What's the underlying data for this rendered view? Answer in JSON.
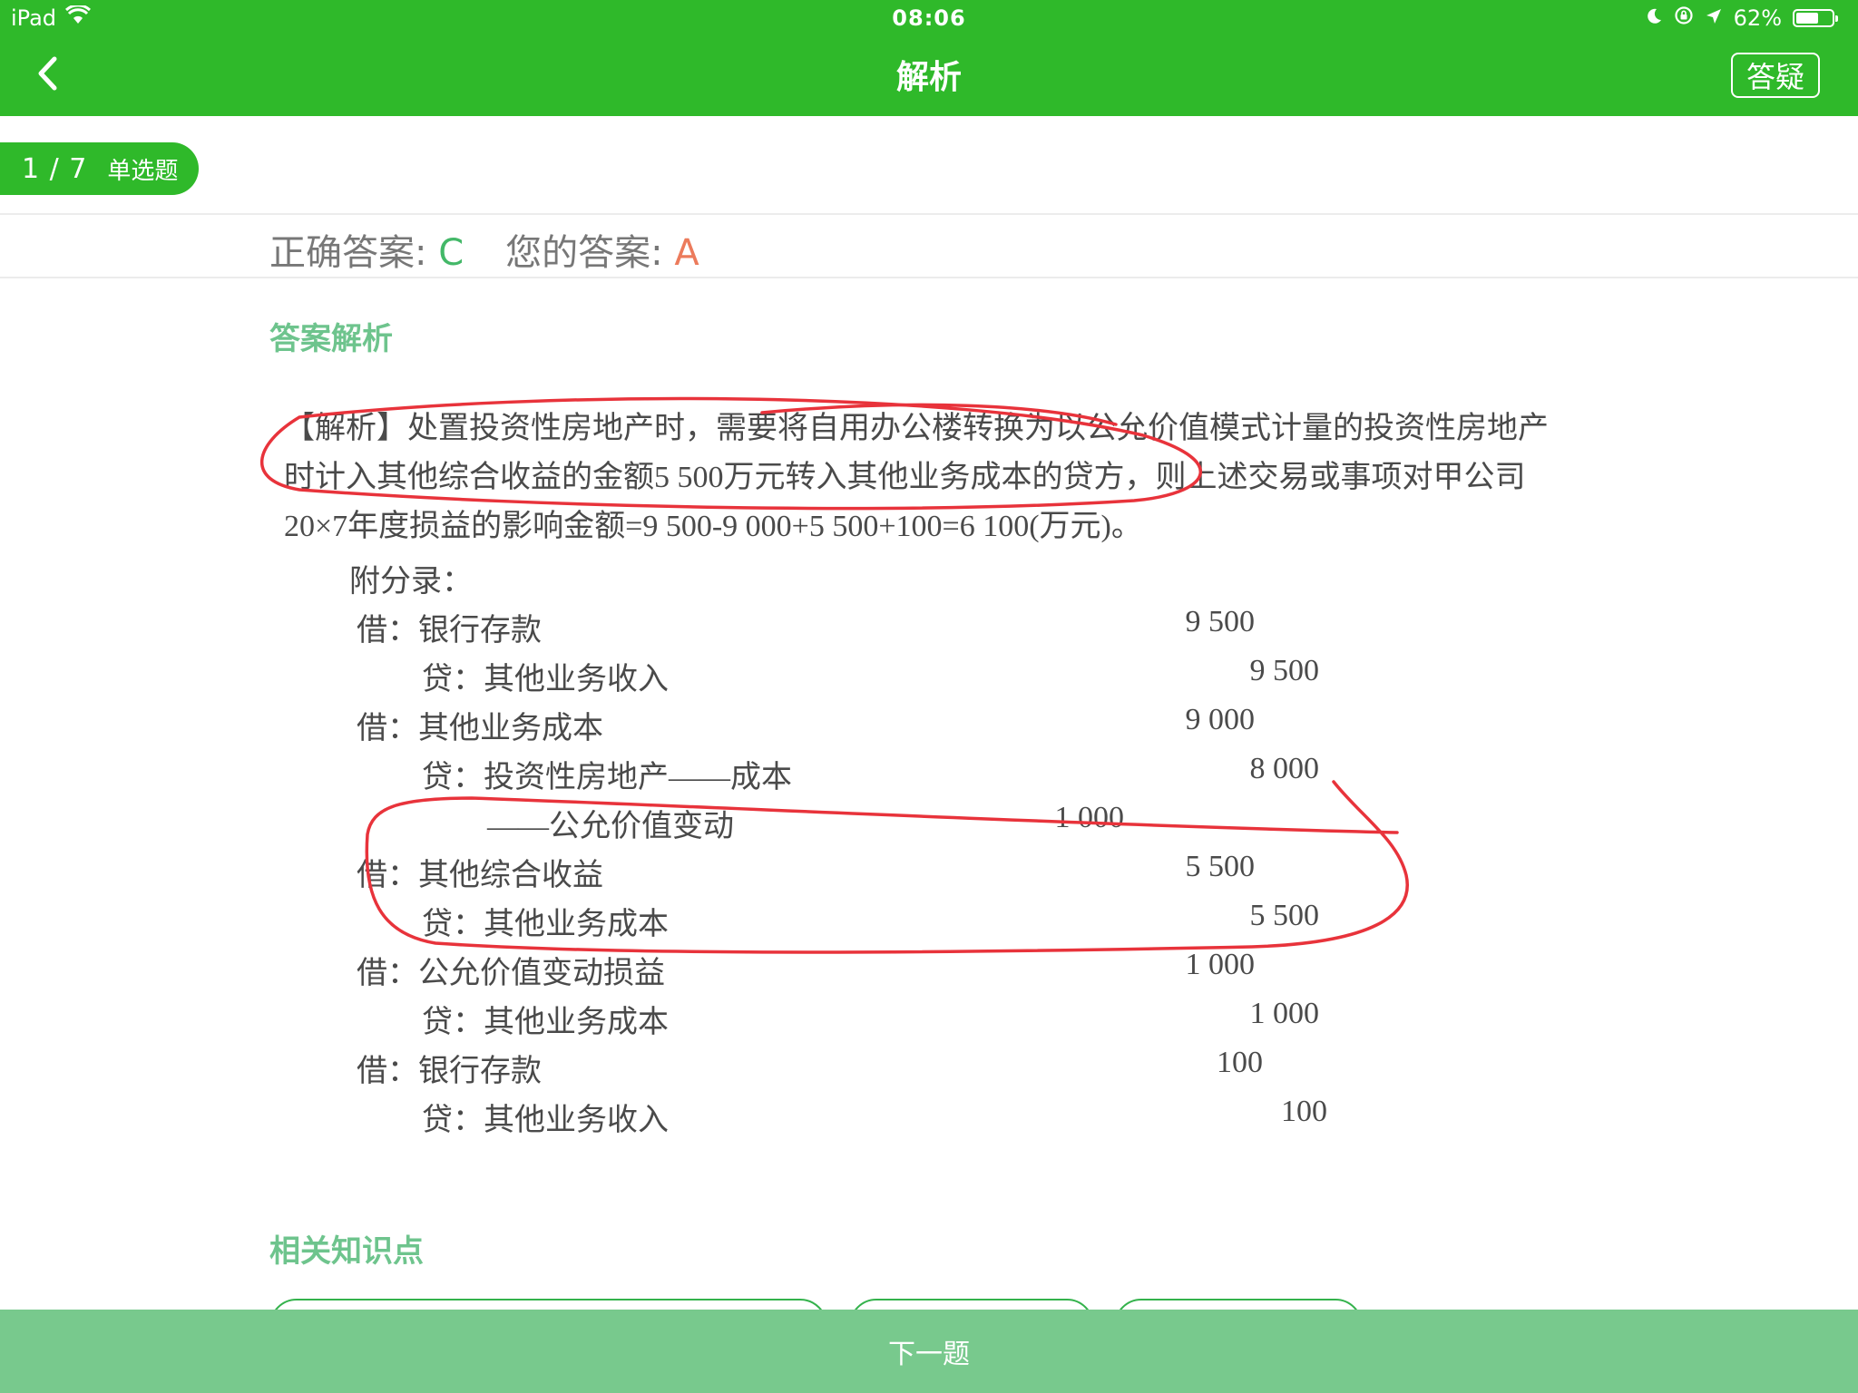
{
  "status_bar": {
    "device": "iPad",
    "time": "08:06",
    "battery_label": "62%",
    "battery_level": 0.62
  },
  "nav": {
    "back_icon": "chevron-left-icon",
    "title": "解析",
    "qa_button": "答疑"
  },
  "progress": {
    "counter": "1 / 7",
    "question_type": "单选题"
  },
  "answers": {
    "correct_label": "正确答案:",
    "correct_value": "C",
    "your_label": "您的答案:",
    "your_value": "A"
  },
  "analysis": {
    "section_title": "答案解析",
    "text": "【解析】处置投资性房地产时，需要将自用办公楼转换为以公允价值模式计量的投资性房地产时计入其他综合收益的金额5 500万元转入其他业务成本的贷方，则上述交易或事项对甲公司20×7年度损益的影响金额=9 500-9 000+5 500+100=6 100(万元)。",
    "entries_title": "附分录：",
    "entries": [
      {
        "label": "借：银行存款",
        "amount": "9 500"
      },
      {
        "label": "贷：其他业务收入",
        "amount": "9 500"
      },
      {
        "label": "借：其他业务成本",
        "amount": "9 000"
      },
      {
        "label": "贷：投资性房地产——成本",
        "amount": "8 000"
      },
      {
        "label": "——公允价值变动",
        "amount": "1 000"
      },
      {
        "label": "借：其他综合收益",
        "amount": "5 500"
      },
      {
        "label": "贷：其他业务成本",
        "amount": "5 500"
      },
      {
        "label": "借：公允价值变动损益",
        "amount": "1 000"
      },
      {
        "label": "贷：其他业务成本",
        "amount": "1 000"
      },
      {
        "label": "借：银行存款",
        "amount": "100"
      },
      {
        "label": "贷：其他业务收入",
        "amount": "100"
      }
    ]
  },
  "knowledge": {
    "section_title": "相关知识点"
  },
  "bottom": {
    "next_button": "下一题"
  },
  "colors": {
    "brand_green": "#2fb92a",
    "correct": "#43b868",
    "wrong": "#ec7b5c",
    "annotation_red": "#e8333b",
    "bottom_bar": "#78c98d"
  }
}
